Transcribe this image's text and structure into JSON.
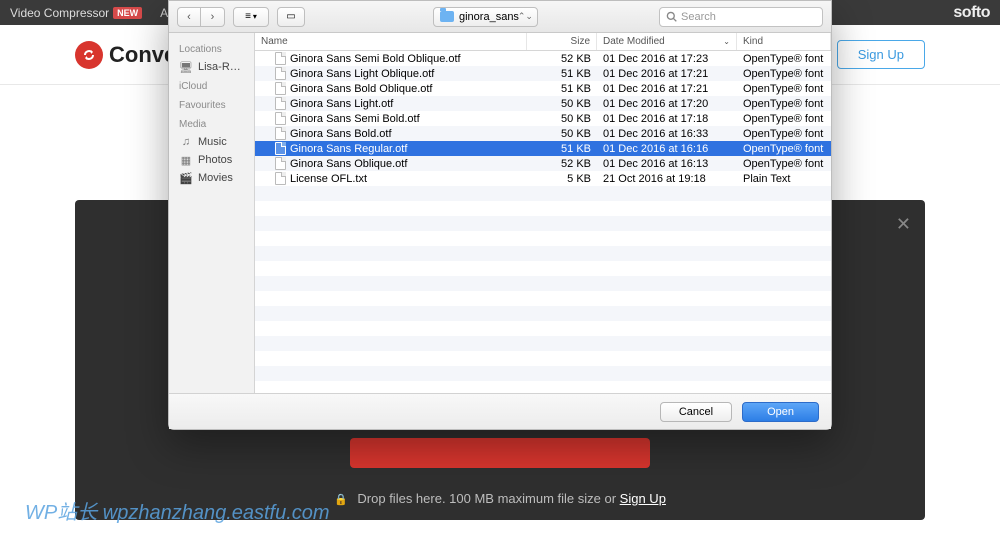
{
  "topbar": {
    "label": "Video Compressor",
    "badge": "NEW",
    "add": "Add Su",
    "brand": "softo"
  },
  "header": {
    "logo": "Conver",
    "signup": "Sign Up"
  },
  "darkpanel": {
    "drop_prefix": "Drop files here. 100 MB maximum file size or ",
    "drop_link": "Sign Up",
    "close": "✕"
  },
  "watermark": "WP站长  wpzhanzhang.eastfu.com",
  "dialog": {
    "path": "ginora_sans",
    "search_placeholder": "Search",
    "cancel": "Cancel",
    "open": "Open",
    "columns": {
      "name": "Name",
      "size": "Size",
      "date": "Date Modified",
      "kind": "Kind"
    },
    "sidebar": {
      "locations_label": "Locations",
      "locations": [
        {
          "label": "Lisa-R…"
        }
      ],
      "icloud_label": "iCloud",
      "favourites_label": "Favourites",
      "media_label": "Media",
      "media": [
        {
          "label": "Music",
          "icon": "music-icon"
        },
        {
          "label": "Photos",
          "icon": "photos-icon"
        },
        {
          "label": "Movies",
          "icon": "movies-icon"
        }
      ]
    },
    "files": [
      {
        "name": "Ginora Sans Semi Bold Oblique.otf",
        "size": "52 KB",
        "date": "01 Dec 2016 at 17:23",
        "kind": "OpenType® font",
        "selected": false
      },
      {
        "name": "Ginora Sans Light Oblique.otf",
        "size": "51 KB",
        "date": "01 Dec 2016 at 17:21",
        "kind": "OpenType® font",
        "selected": false
      },
      {
        "name": "Ginora Sans Bold Oblique.otf",
        "size": "51 KB",
        "date": "01 Dec 2016 at 17:21",
        "kind": "OpenType® font",
        "selected": false
      },
      {
        "name": "Ginora Sans Light.otf",
        "size": "50 KB",
        "date": "01 Dec 2016 at 17:20",
        "kind": "OpenType® font",
        "selected": false
      },
      {
        "name": "Ginora Sans Semi Bold.otf",
        "size": "50 KB",
        "date": "01 Dec 2016 at 17:18",
        "kind": "OpenType® font",
        "selected": false
      },
      {
        "name": "Ginora Sans Bold.otf",
        "size": "50 KB",
        "date": "01 Dec 2016 at 16:33",
        "kind": "OpenType® font",
        "selected": false
      },
      {
        "name": "Ginora Sans Regular.otf",
        "size": "51 KB",
        "date": "01 Dec 2016 at 16:16",
        "kind": "OpenType® font",
        "selected": true
      },
      {
        "name": "Ginora Sans Oblique.otf",
        "size": "52 KB",
        "date": "01 Dec 2016 at 16:13",
        "kind": "OpenType® font",
        "selected": false
      },
      {
        "name": "License OFL.txt",
        "size": "5 KB",
        "date": "21 Oct 2016 at 19:18",
        "kind": "Plain Text",
        "selected": false
      }
    ]
  }
}
